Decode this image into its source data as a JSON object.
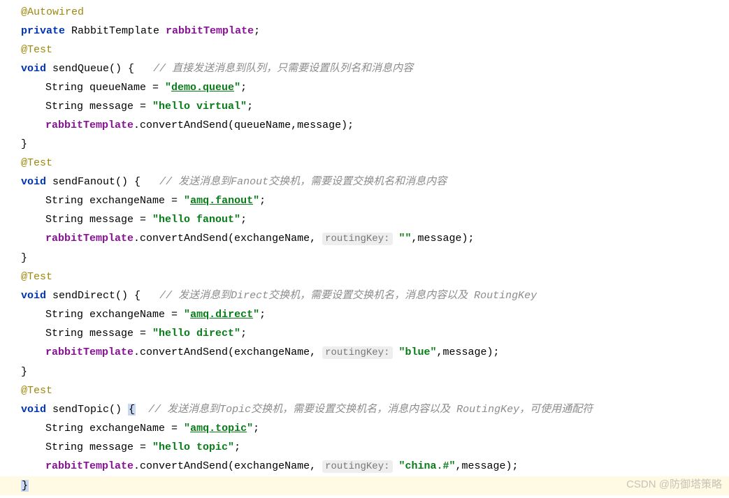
{
  "lines": {
    "l1": "@Autowired",
    "l2_private": "private",
    "l2_type": " RabbitTemplate ",
    "l2_field": "rabbitTemplate",
    "l2_semi": ";",
    "l3": "@Test",
    "l4_void": "void",
    "l4_method": " sendQueue() ",
    "l4_brace": "{",
    "l4_comment": "   // 直接发送消息到队列，只需要设置队列名和消息内容",
    "l5_a": "String queueName = ",
    "l5_b": "\"",
    "l5_c": "demo.queue",
    "l5_d": "\"",
    "l5_e": ";",
    "l6_a": "String message = ",
    "l6_b": "\"hello virtual\"",
    "l6_c": ";",
    "l7_a": "rabbitTemplate",
    "l7_b": ".convertAndSend(queueName,message);",
    "l8": "}",
    "l9": "@Test",
    "l10_void": "void",
    "l10_method": " sendFanout() ",
    "l10_brace": "{",
    "l10_comment": "   // 发送消息到Fanout交换机，需要设置交换机名和消息内容",
    "l11_a": "String exchangeName = ",
    "l11_b": "\"",
    "l11_c": "amq.fanout",
    "l11_d": "\"",
    "l11_e": ";",
    "l12_a": "String message = ",
    "l12_b": "\"hello fanout\"",
    "l12_c": ";",
    "l13_a": "rabbitTemplate",
    "l13_b": ".convertAndSend(exchangeName, ",
    "l13_hint": "routingKey:",
    "l13_c": " ",
    "l13_d": "\"\"",
    "l13_e": ",message);",
    "l14": "}",
    "l15": "@Test",
    "l16_void": "void",
    "l16_method": " sendDirect() ",
    "l16_brace": "{",
    "l16_comment": "   // 发送消息到Direct交换机，需要设置交换机名，消息内容以及 RoutingKey",
    "l17_a": "String exchangeName = ",
    "l17_b": "\"",
    "l17_c": "amq.direct",
    "l17_d": "\"",
    "l17_e": ";",
    "l18_a": "String message = ",
    "l18_b": "\"hello direct\"",
    "l18_c": ";",
    "l19_a": "rabbitTemplate",
    "l19_b": ".convertAndSend(exchangeName, ",
    "l19_hint": "routingKey:",
    "l19_c": " ",
    "l19_d": "\"blue\"",
    "l19_e": ",message);",
    "l20": "}",
    "l21": "@Test",
    "l22_void": "void",
    "l22_method": " sendTopic() ",
    "l22_brace": "{",
    "l22_comment": "  // 发送消息到Topic交换机，需要设置交换机名，消息内容以及 RoutingKey，可使用通配符",
    "l23_a": "String exchangeName = ",
    "l23_b": "\"",
    "l23_c": "amq.topic",
    "l23_d": "\"",
    "l23_e": ";",
    "l24_a": "String message = ",
    "l24_b": "\"hello topic\"",
    "l24_c": ";",
    "l25_a": "rabbitTemplate",
    "l25_b": ".convertAndSend(exchangeName, ",
    "l25_hint": "routingKey:",
    "l25_c": " ",
    "l25_d": "\"china.#\"",
    "l25_e": ",message);",
    "l26": "}",
    "watermark": "CSDN @防御塔策略"
  }
}
